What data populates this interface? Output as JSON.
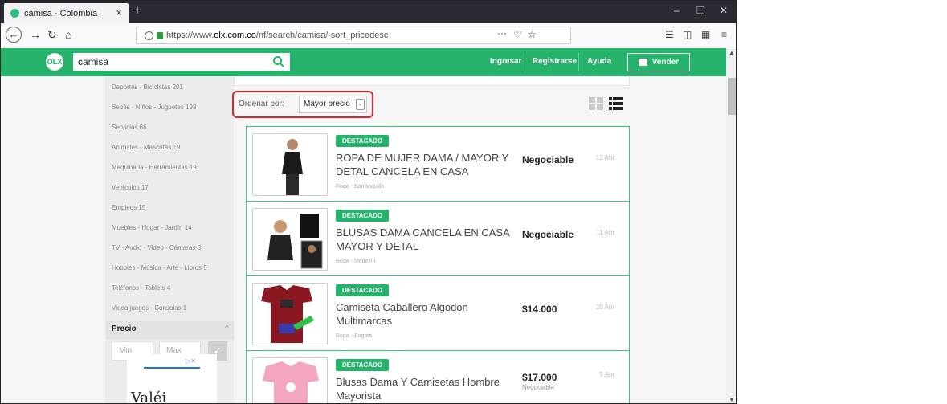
{
  "browser": {
    "tab_title": "camisa - Colombia",
    "tab_close": "×",
    "new_tab": "+",
    "url_prefix": "https://www.",
    "url_domain": "olx.com.co",
    "url_path": "/nf/search/camisa/-sort_pricedesc",
    "url_more": "···"
  },
  "header": {
    "logo": "OLX",
    "search_value": "camisa",
    "links": [
      "Ingresar",
      "Registrarse",
      "Ayuda"
    ],
    "sell_label": "Vender",
    "brand_color": "#25b36c"
  },
  "sidebar": {
    "categories": [
      "Deportes - Bicicletas 201",
      "Bebés - Niños - Juguetes 198",
      "Servicios 66",
      "Animales - Mascotas 19",
      "Maquinaria - Herramientas 19",
      "Vehículos 17",
      "Empleos 15",
      "Muebles - Hogar - Jardín 14",
      "TV - Audio - Video - Cámaras 8",
      "Hobbies - Música - Arte - Libros 5",
      "Teléfonos - Tablets 4",
      "Video juegos - Consolas 1"
    ],
    "price_title": "Precio",
    "min_placeholder": "Min",
    "max_placeholder": "Max",
    "ad_text": "Valéi"
  },
  "sort": {
    "label": "Ordenar por:",
    "selected": "Mayor precio",
    "highlight_color": "#e0242b"
  },
  "listings": [
    {
      "badge": "DESTACADO",
      "title": "ROPA DE MUJER DAMA / MAYOR Y DETAL CANCELA EN CASA",
      "location": "Ropa - Barranquilla",
      "price": "Negociable",
      "subprice": "",
      "date": "12 Abr"
    },
    {
      "badge": "DESTACADO",
      "title": "BLUSAS DAMA CANCELA EN CASA MAYOR Y DETAL",
      "location": "Ropa - Medellín",
      "price": "Negociable",
      "subprice": "",
      "date": "11 Abr"
    },
    {
      "badge": "DESTACADO",
      "title": "Camiseta Caballero Algodon Multimarcas",
      "location": "Ropa - Bogotá",
      "price": "$14.000",
      "subprice": "",
      "date": "20 Abr"
    },
    {
      "badge": "DESTACADO",
      "title": "Blusas Dama Y Camisetas Hombre Mayorista",
      "location": "",
      "price": "$17.000",
      "subprice": "Negociable",
      "date": "5 Abr"
    }
  ]
}
